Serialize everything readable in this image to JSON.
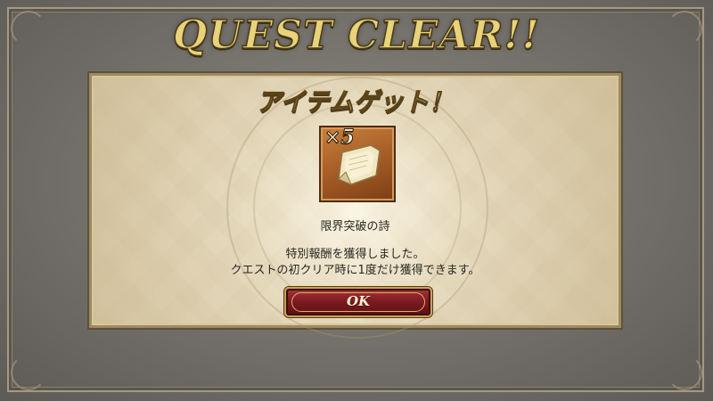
{
  "screen": {
    "title": "QUEST CLEAR!!"
  },
  "reward_panel": {
    "heading": "アイテムゲット！",
    "item": {
      "name": "限界突破の詩",
      "quantity": "×5",
      "icon": "scroll-icon"
    },
    "message_line1": "特別報酬を獲得しました。",
    "message_line2": "クエストの初クリア時に1度だけ獲得できます。",
    "ok_label": "OK"
  },
  "colors": {
    "title_gold": "#e8d27a",
    "button_red": "#7a1a20",
    "panel_parchment": "#e3d6b6",
    "icon_orange": "#a25a24"
  }
}
